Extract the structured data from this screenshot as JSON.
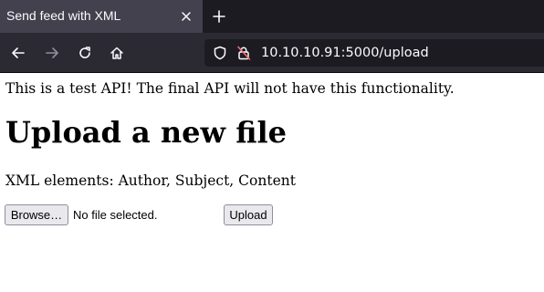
{
  "browser": {
    "tab": {
      "title": "Send feed with XML",
      "close_icon": "close-icon"
    },
    "new_tab_icon": "plus-icon",
    "nav": {
      "back_icon": "arrow-left-icon",
      "forward_icon": "arrow-right-icon",
      "forward_enabled": false,
      "reload_icon": "reload-icon",
      "home_icon": "home-icon"
    },
    "urlbar": {
      "shield_icon": "shield-icon",
      "lock_icon": "insecure-lock-icon",
      "url": "10.10.10.91:5000/upload"
    },
    "colors": {
      "tabstrip_bg": "#1c1b22",
      "active_tab_bg": "#42414d",
      "navbar_bg": "#2b2a33",
      "urlbar_bg": "#1c1b22",
      "insecure_accent": "#ff6a75"
    }
  },
  "page": {
    "notice": "This is a test API! The final API will not have this functionality.",
    "heading": "Upload a new file",
    "xml_elements": "XML elements: Author, Subject, Content",
    "file_input": {
      "browse_label": "Browse…",
      "status": "No file selected."
    },
    "upload_label": "Upload"
  }
}
